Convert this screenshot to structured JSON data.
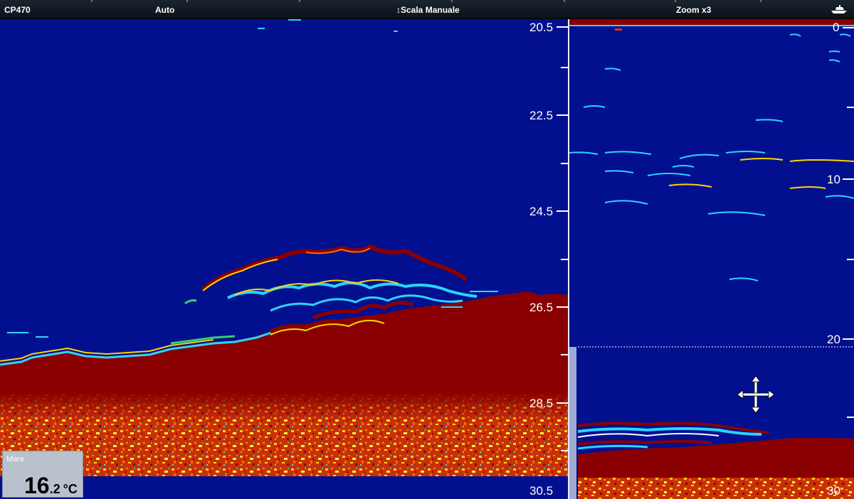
{
  "header": {
    "title": "CP470",
    "gain_mode": "Auto",
    "range_mode": "Scala Manuale",
    "zoom": "Zoom x3"
  },
  "icons": {
    "vessel": "boat-icon",
    "range": "vertical-arrows-icon",
    "pan": "move-cursor-icon"
  },
  "left_scale": {
    "labels": [
      "20.5",
      "22.5",
      "24.5",
      "26.5",
      "28.5",
      "30.5"
    ],
    "range": [
      20.5,
      30.5
    ]
  },
  "right_scale": {
    "labels": [
      "0",
      "10",
      "20",
      "30"
    ],
    "range": [
      0,
      30
    ]
  },
  "water_temp": {
    "label": "Mare",
    "integer": "16",
    "decimal": ".2",
    "unit": "°C"
  },
  "colors": {
    "water": "#02108f",
    "bottom": "#8a0000",
    "strong_echo": "#ffd400",
    "weak_echo": "#2ad4ff"
  }
}
